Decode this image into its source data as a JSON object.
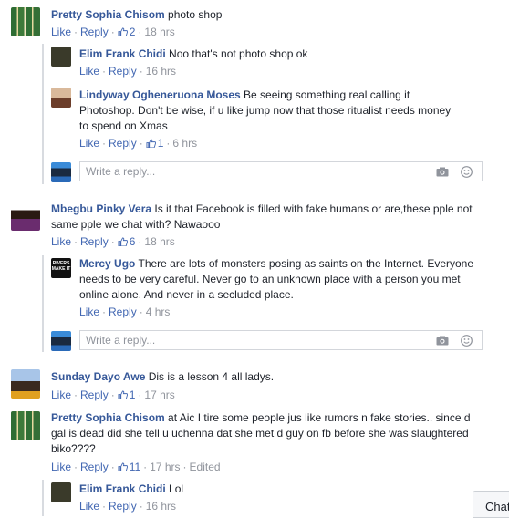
{
  "ui": {
    "like": "Like",
    "reply": "Reply",
    "reply_placeholder": "Write a reply...",
    "chat_tab": "Chat"
  },
  "comments": [
    {
      "author": "Pretty Sophia Chisom",
      "text": "photo shop",
      "likes": "2",
      "time": "18 hrs"
    },
    {
      "author": "Elim Frank Chidi",
      "text": "Noo that's not photo shop ok",
      "time": "16 hrs"
    },
    {
      "author": "Lindyway Ogheneruona Moses",
      "text": "Be seeing something real calling it Photoshop. Don't be wise, if u like jump now that those ritualist needs money to spend on Xmas",
      "likes": "1",
      "time": "6 hrs"
    },
    {
      "author": "Mbegbu Pinky Vera",
      "text": "Is it that Facebook is filled with fake humans or are,these pple not same pple we chat with? Nawaooo",
      "likes": "6",
      "time": "18 hrs"
    },
    {
      "author": "Mercy Ugo",
      "text": "There are lots of monsters posing as saints on the Internet. Everyone needs to be very careful. Never go to an unknown place with a person you met online alone. And never in a secluded place.",
      "time": "4 hrs",
      "avatar_text": "RIVERS MAKE IT"
    },
    {
      "author": "Sunday Dayo Awe",
      "text": "Dis is a lesson 4 all ladys.",
      "likes": "1",
      "time": "17 hrs"
    },
    {
      "author": "Pretty Sophia Chisom",
      "text": "at Aic I tire some people jus like rumors n fake stories.. since d gal is dead did she tell u uchenna dat she met d guy on fb before she was slaughtered biko????",
      "likes": "11",
      "time": "17 hrs",
      "edited": "Edited"
    },
    {
      "author": "Elim Frank Chidi",
      "text": "Lol",
      "time": "16 hrs"
    }
  ],
  "colors": {
    "link": "#4267b2",
    "name": "#365899",
    "meta": "#90949c"
  }
}
